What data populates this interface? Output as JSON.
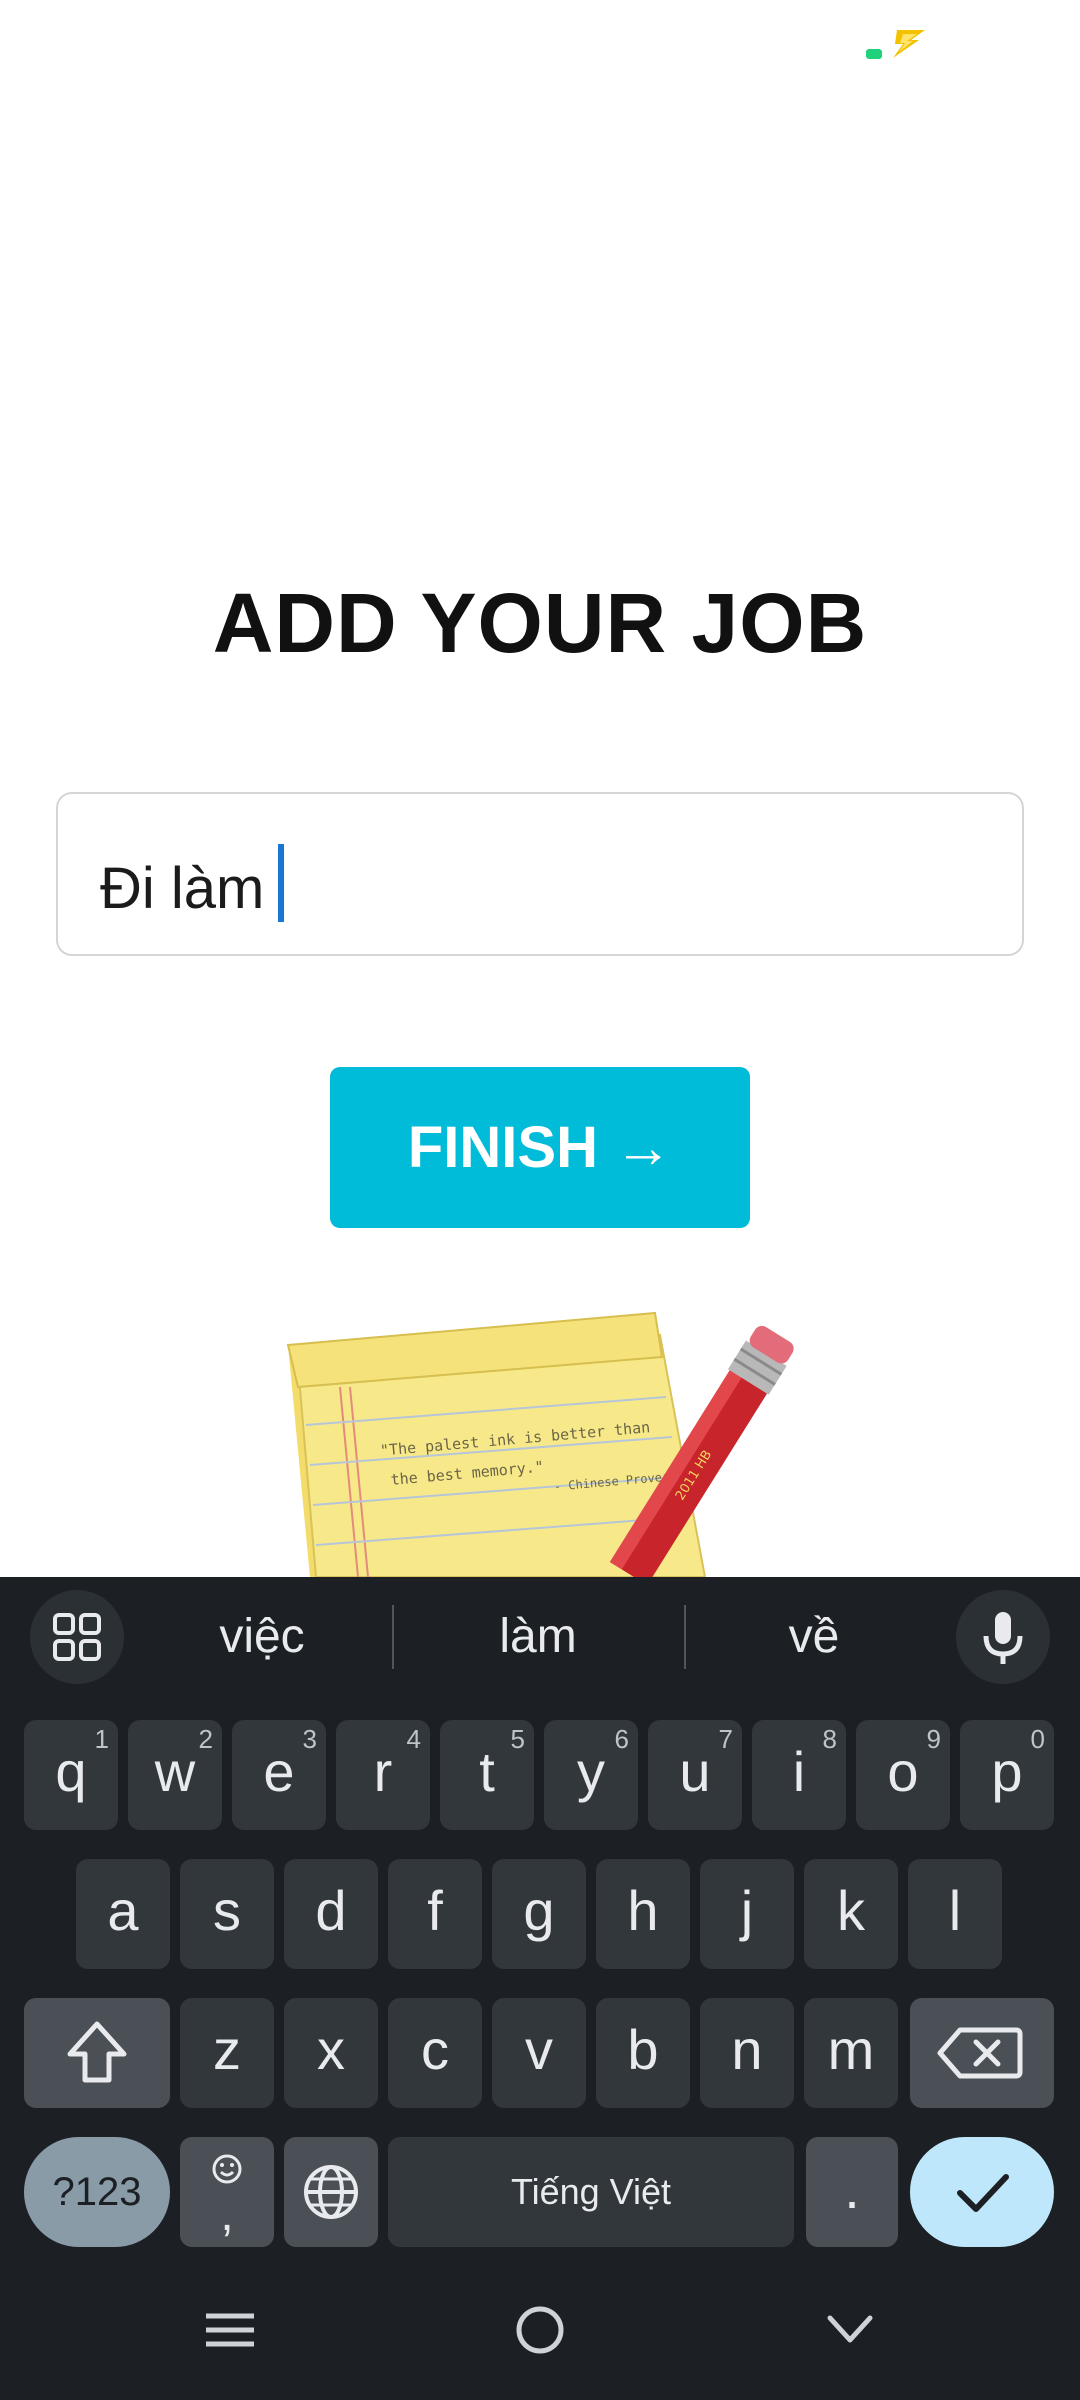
{
  "page": {
    "title": "ADD YOUR JOB",
    "input_value": "Đi làm",
    "finish_label": "FINISH →"
  },
  "notepad": {
    "quote_line1": "\"The palest ink is better than",
    "quote_line2": "the best memory.\"",
    "attribution": "- Chinese Proverb",
    "pencil_text": "2011 HB"
  },
  "keyboard": {
    "suggestions": [
      "việc",
      "làm",
      "về"
    ],
    "row1": [
      {
        "label": "q",
        "hint": "1"
      },
      {
        "label": "w",
        "hint": "2"
      },
      {
        "label": "e",
        "hint": "3"
      },
      {
        "label": "r",
        "hint": "4"
      },
      {
        "label": "t",
        "hint": "5"
      },
      {
        "label": "y",
        "hint": "6"
      },
      {
        "label": "u",
        "hint": "7"
      },
      {
        "label": "i",
        "hint": "8"
      },
      {
        "label": "o",
        "hint": "9"
      },
      {
        "label": "p",
        "hint": "0"
      }
    ],
    "row2": [
      "a",
      "s",
      "d",
      "f",
      "g",
      "h",
      "j",
      "k",
      "l"
    ],
    "row3": [
      "z",
      "x",
      "c",
      "v",
      "b",
      "n",
      "m"
    ],
    "symbols_label": "?123",
    "comma_label": ",",
    "space_label": "Tiếng Việt",
    "period_label": "."
  },
  "colors": {
    "accent": "#00bcd8",
    "keyboard_bg": "#1c2024",
    "key_bg": "#32373c",
    "enter_bg": "#bfe7fb"
  },
  "icons": {
    "status": "charging-bolt-icon",
    "grid": "apps-grid-icon",
    "mic": "microphone-icon",
    "shift": "shift-arrow-icon",
    "backspace": "backspace-icon",
    "emoji": "emoji-icon",
    "globe": "globe-icon",
    "enter": "checkmark-icon",
    "nav_menu": "menu-lines-icon",
    "nav_home": "home-circle-icon",
    "nav_back": "chevron-down-icon"
  }
}
